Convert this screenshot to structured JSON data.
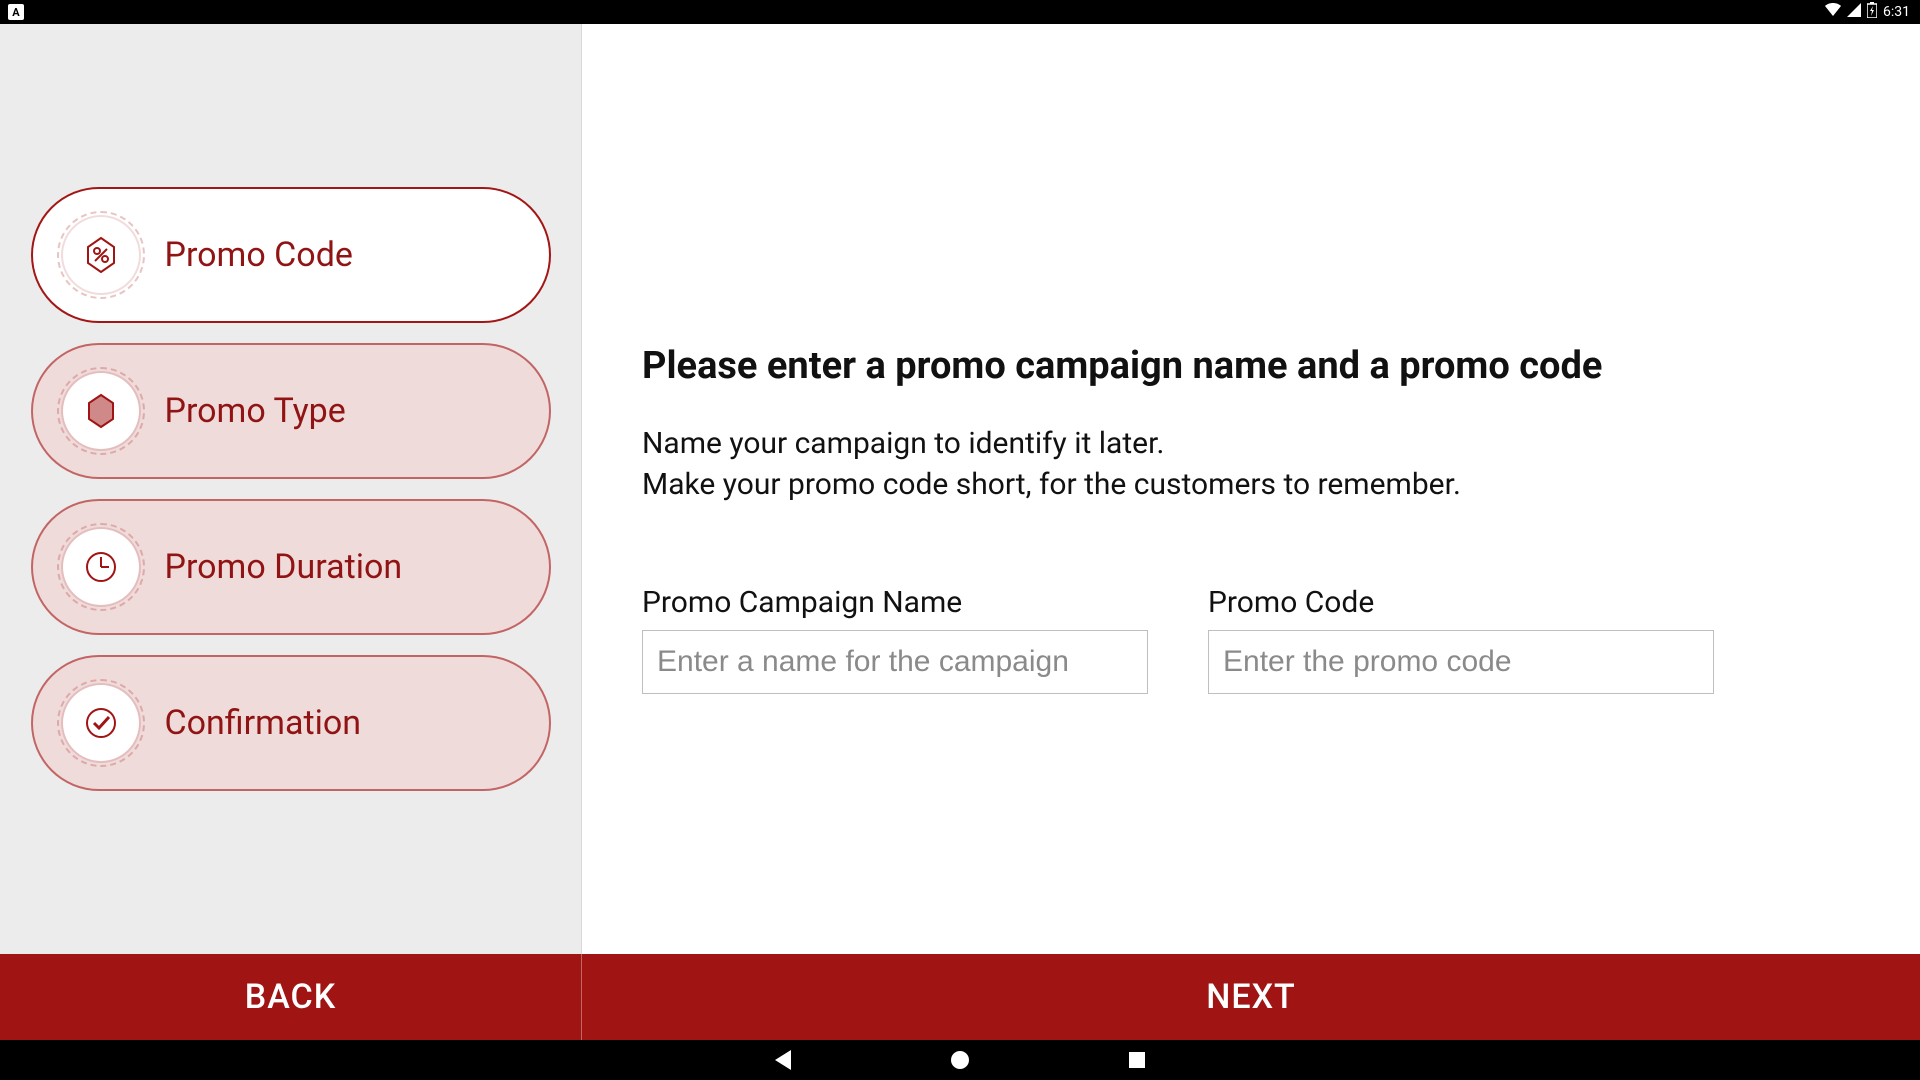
{
  "statusbar": {
    "app_letter": "A",
    "time": "6:31"
  },
  "sidebar": {
    "steps": [
      {
        "label": "Promo Code",
        "icon": "percent-icon",
        "active": true
      },
      {
        "label": "Promo Type",
        "icon": "tag-icon",
        "active": false
      },
      {
        "label": "Promo Duration",
        "icon": "clock-icon",
        "active": false
      },
      {
        "label": "Confirmation",
        "icon": "check-icon",
        "active": false
      }
    ]
  },
  "main": {
    "headline": "Please enter a promo campaign name and a promo code",
    "subtext_line1": "Name your campaign to identify it later.",
    "subtext_line2": "Make your promo code short, for the customers to remember.",
    "campaign_label": "Promo Campaign Name",
    "campaign_placeholder": "Enter a name for the campaign",
    "campaign_value": "",
    "code_label": "Promo Code",
    "code_placeholder": "Enter the promo code",
    "code_value": ""
  },
  "footer": {
    "back": "BACK",
    "next": "NEXT"
  },
  "colors": {
    "brand": "#A01414",
    "sidebar_bg": "#ECECEC",
    "step_inactive_bg": "#F0DBDB"
  }
}
